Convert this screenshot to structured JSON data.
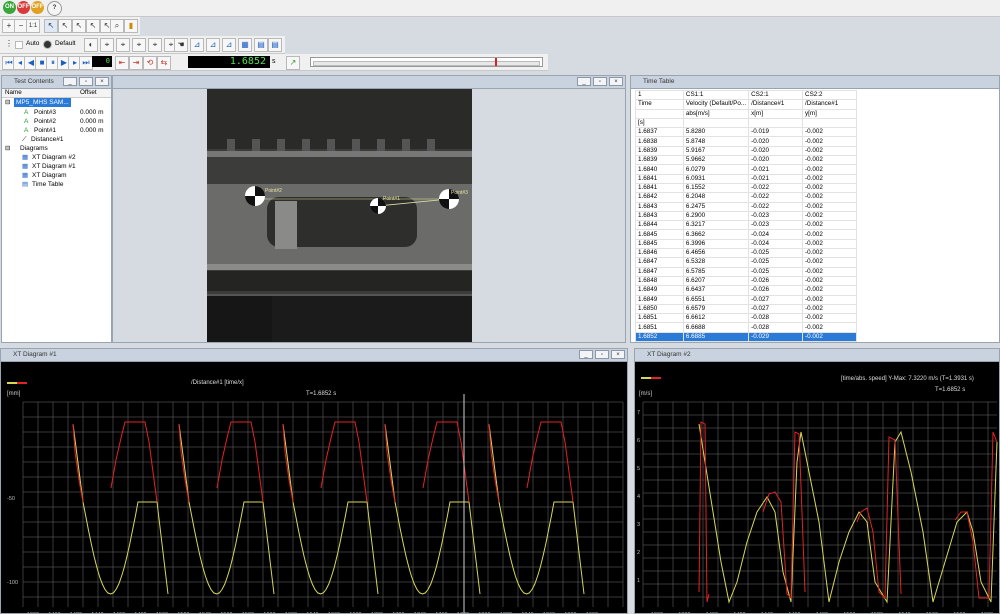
{
  "toolbar": {
    "row1_circles": [
      "ON",
      "OFF",
      "OFF"
    ],
    "zoom_label": "1:1",
    "auto_label": "Auto",
    "default_label": "Default",
    "counter": "0",
    "time_display": "1.6852",
    "time_unit": "s"
  },
  "test_contents": {
    "title": "Test Contents",
    "col_name": "Name",
    "col_offset": "Offset",
    "root": "MP5_MHS SAM...",
    "points": [
      {
        "name": "Point#3",
        "offset": "0.000 m"
      },
      {
        "name": "Point#2",
        "offset": "0.000 m"
      },
      {
        "name": "Point#1",
        "offset": "0.000 m"
      }
    ],
    "distance": "Distance#1",
    "diagrams_label": "Diagrams",
    "diagrams": [
      "XT Diagram #2",
      "XT Diagram #1",
      "XT Diagram",
      "Time Table"
    ]
  },
  "video": {
    "markers": [
      "Point#2",
      "Point#1",
      "Point#3"
    ]
  },
  "time_table": {
    "title": "Time Table",
    "header1": [
      "1",
      "CS1:1",
      "CS2:1",
      "CS2:2"
    ],
    "header2": [
      "Time",
      "Velocity (Default/Po...",
      "/Distance#1",
      "/Distance#1"
    ],
    "header3": [
      "",
      "abs[m/s]",
      "x[m]",
      "y[m]"
    ],
    "header4": [
      "[s]",
      "",
      "",
      ""
    ],
    "rows": [
      [
        "1.6837",
        "5.8280",
        "-0.019",
        "-0.002"
      ],
      [
        "1.6838",
        "5.8748",
        "-0.020",
        "-0.002"
      ],
      [
        "1.6839",
        "5.9167",
        "-0.020",
        "-0.002"
      ],
      [
        "1.6839",
        "5.9662",
        "-0.020",
        "-0.002"
      ],
      [
        "1.6840",
        "6.0279",
        "-0.021",
        "-0.002"
      ],
      [
        "1.6841",
        "6.0931",
        "-0.021",
        "-0.002"
      ],
      [
        "1.6841",
        "6.1552",
        "-0.022",
        "-0.002"
      ],
      [
        "1.6842",
        "6.2048",
        "-0.022",
        "-0.002"
      ],
      [
        "1.6843",
        "6.2475",
        "-0.022",
        "-0.002"
      ],
      [
        "1.6843",
        "6.2900",
        "-0.023",
        "-0.002"
      ],
      [
        "1.6844",
        "6.3217",
        "-0.023",
        "-0.002"
      ],
      [
        "1.6845",
        "6.3662",
        "-0.024",
        "-0.002"
      ],
      [
        "1.6845",
        "6.3996",
        "-0.024",
        "-0.002"
      ],
      [
        "1.6846",
        "6.4656",
        "-0.025",
        "-0.002"
      ],
      [
        "1.6847",
        "6.5328",
        "-0.025",
        "-0.002"
      ],
      [
        "1.6847",
        "6.5785",
        "-0.025",
        "-0.002"
      ],
      [
        "1.6848",
        "6.6207",
        "-0.026",
        "-0.002"
      ],
      [
        "1.6849",
        "6.6437",
        "-0.026",
        "-0.002"
      ],
      [
        "1.6849",
        "6.6551",
        "-0.027",
        "-0.002"
      ],
      [
        "1.6850",
        "6.6579",
        "-0.027",
        "-0.002"
      ],
      [
        "1.6851",
        "6.6612",
        "-0.028",
        "-0.002"
      ],
      [
        "1.6851",
        "6.6688",
        "-0.028",
        "-0.002"
      ],
      [
        "1.6852",
        "6.6885",
        "-0.029",
        "-0.002"
      ]
    ],
    "selected_index": 22
  },
  "xt1": {
    "title": "XT Diagram #1",
    "series_label": "/Distance#1 [time/x]",
    "cursor_label": "T=1.6852 s",
    "unit": "[mm]",
    "y_ticks": [
      "-50",
      "-100"
    ],
    "x_ticks": [
      "1380",
      "1400",
      "1420",
      "1440",
      "1460",
      "1480",
      "1500",
      "1520",
      "1540",
      "1560",
      "1580",
      "1600",
      "1620",
      "1640",
      "1660",
      "1680",
      "1700",
      "1720",
      "1740",
      "1760",
      "1780",
      "1800",
      "1820",
      "1840",
      "1860",
      "1880",
      "1900"
    ]
  },
  "xt2": {
    "title": "XT Diagram #2",
    "series_label": "[time/abs. speed] Y-Max: 7.3220 m/s (T=1.3931 s)",
    "cursor_label": "T=1.6852 s",
    "unit": "[m/s]",
    "y_ticks": [
      "7",
      "6",
      "5",
      "4",
      "3",
      "2",
      "1"
    ],
    "x_ticks": [
      "1360",
      "1380",
      "1400",
      "1420",
      "1440",
      "1460",
      "1480",
      "1500",
      "1520",
      "1540",
      "1560",
      "1580",
      "1600"
    ]
  },
  "colors": {
    "plot_bg": "#000000",
    "grid": "#6e6e6e",
    "trace_yellow": "#d7d75a",
    "trace_red": "#e02424",
    "selection": "#2a7ad8"
  }
}
